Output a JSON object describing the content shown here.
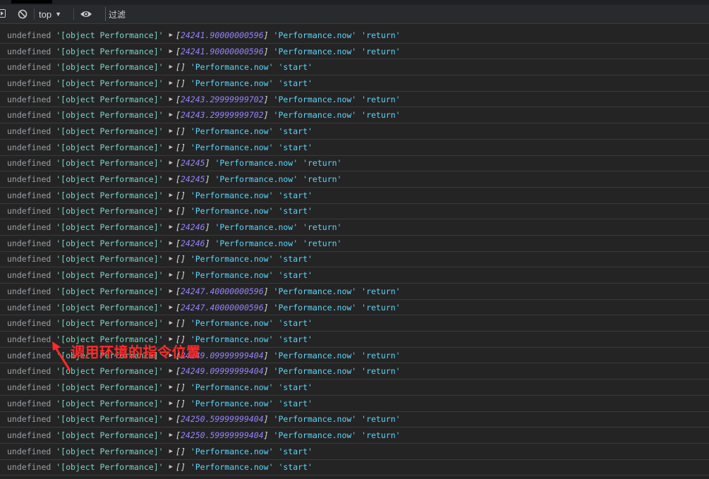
{
  "toolbar": {
    "context_label": "top",
    "filter_placeholder": "过滤"
  },
  "rows": [
    {
      "undef": "undefined",
      "perf": "'[object Performance]'",
      "arr_open": "[",
      "value": "24241.90000000596",
      "arr_close": "]",
      "fn": "'Performance.now'",
      "state": "'return'"
    },
    {
      "undef": "undefined",
      "perf": "'[object Performance]'",
      "arr_open": "[",
      "value": "24241.90000000596",
      "arr_close": "]",
      "fn": "'Performance.now'",
      "state": "'return'"
    },
    {
      "undef": "undefined",
      "perf": "'[object Performance]'",
      "arr_open": "[",
      "value": "",
      "arr_close": "]",
      "fn": "'Performance.now'",
      "state": "'start'"
    },
    {
      "undef": "undefined",
      "perf": "'[object Performance]'",
      "arr_open": "[",
      "value": "",
      "arr_close": "]",
      "fn": "'Performance.now'",
      "state": "'start'"
    },
    {
      "undef": "undefined",
      "perf": "'[object Performance]'",
      "arr_open": "[",
      "value": "24243.29999999702",
      "arr_close": "]",
      "fn": "'Performance.now'",
      "state": "'return'"
    },
    {
      "undef": "undefined",
      "perf": "'[object Performance]'",
      "arr_open": "[",
      "value": "24243.29999999702",
      "arr_close": "]",
      "fn": "'Performance.now'",
      "state": "'return'"
    },
    {
      "undef": "undefined",
      "perf": "'[object Performance]'",
      "arr_open": "[",
      "value": "",
      "arr_close": "]",
      "fn": "'Performance.now'",
      "state": "'start'"
    },
    {
      "undef": "undefined",
      "perf": "'[object Performance]'",
      "arr_open": "[",
      "value": "",
      "arr_close": "]",
      "fn": "'Performance.now'",
      "state": "'start'"
    },
    {
      "undef": "undefined",
      "perf": "'[object Performance]'",
      "arr_open": "[",
      "value": "24245",
      "arr_close": "]",
      "fn": "'Performance.now'",
      "state": "'return'"
    },
    {
      "undef": "undefined",
      "perf": "'[object Performance]'",
      "arr_open": "[",
      "value": "24245",
      "arr_close": "]",
      "fn": "'Performance.now'",
      "state": "'return'"
    },
    {
      "undef": "undefined",
      "perf": "'[object Performance]'",
      "arr_open": "[",
      "value": "",
      "arr_close": "]",
      "fn": "'Performance.now'",
      "state": "'start'"
    },
    {
      "undef": "undefined",
      "perf": "'[object Performance]'",
      "arr_open": "[",
      "value": "",
      "arr_close": "]",
      "fn": "'Performance.now'",
      "state": "'start'"
    },
    {
      "undef": "undefined",
      "perf": "'[object Performance]'",
      "arr_open": "[",
      "value": "24246",
      "arr_close": "]",
      "fn": "'Performance.now'",
      "state": "'return'"
    },
    {
      "undef": "undefined",
      "perf": "'[object Performance]'",
      "arr_open": "[",
      "value": "24246",
      "arr_close": "]",
      "fn": "'Performance.now'",
      "state": "'return'"
    },
    {
      "undef": "undefined",
      "perf": "'[object Performance]'",
      "arr_open": "[",
      "value": "",
      "arr_close": "]",
      "fn": "'Performance.now'",
      "state": "'start'"
    },
    {
      "undef": "undefined",
      "perf": "'[object Performance]'",
      "arr_open": "[",
      "value": "",
      "arr_close": "]",
      "fn": "'Performance.now'",
      "state": "'start'"
    },
    {
      "undef": "undefined",
      "perf": "'[object Performance]'",
      "arr_open": "[",
      "value": "24247.40000000596",
      "arr_close": "]",
      "fn": "'Performance.now'",
      "state": "'return'"
    },
    {
      "undef": "undefined",
      "perf": "'[object Performance]'",
      "arr_open": "[",
      "value": "24247.40000000596",
      "arr_close": "]",
      "fn": "'Performance.now'",
      "state": "'return'"
    },
    {
      "undef": "undefined",
      "perf": "'[object Performance]'",
      "arr_open": "[",
      "value": "",
      "arr_close": "]",
      "fn": "'Performance.now'",
      "state": "'start'"
    },
    {
      "undef": "undefined",
      "perf": "'[object Performance]'",
      "arr_open": "[",
      "value": "",
      "arr_close": "]",
      "fn": "'Performance.now'",
      "state": "'start'"
    },
    {
      "undef": "undefined",
      "perf": "'[object Performance]'",
      "arr_open": "[",
      "value": "24249.09999999404",
      "arr_close": "]",
      "fn": "'Performance.now'",
      "state": "'return'"
    },
    {
      "undef": "undefined",
      "perf": "'[object Performance]'",
      "arr_open": "[",
      "value": "24249.09999999404",
      "arr_close": "]",
      "fn": "'Performance.now'",
      "state": "'return'"
    },
    {
      "undef": "undefined",
      "perf": "'[object Performance]'",
      "arr_open": "[",
      "value": "",
      "arr_close": "]",
      "fn": "'Performance.now'",
      "state": "'start'"
    },
    {
      "undef": "undefined",
      "perf": "'[object Performance]'",
      "arr_open": "[",
      "value": "",
      "arr_close": "]",
      "fn": "'Performance.now'",
      "state": "'start'"
    },
    {
      "undef": "undefined",
      "perf": "'[object Performance]'",
      "arr_open": "[",
      "value": "24250.59999999404",
      "arr_close": "]",
      "fn": "'Performance.now'",
      "state": "'return'"
    },
    {
      "undef": "undefined",
      "perf": "'[object Performance]'",
      "arr_open": "[",
      "value": "24250.59999999404",
      "arr_close": "]",
      "fn": "'Performance.now'",
      "state": "'return'"
    },
    {
      "undef": "undefined",
      "perf": "'[object Performance]'",
      "arr_open": "[",
      "value": "",
      "arr_close": "]",
      "fn": "'Performance.now'",
      "state": "'start'"
    },
    {
      "undef": "undefined",
      "perf": "'[object Performance]'",
      "arr_open": "[",
      "value": "",
      "arr_close": "]",
      "fn": "'Performance.now'",
      "state": "'start'"
    }
  ],
  "annotation": {
    "text": "调用环境的指令位置",
    "color": "#ff2a2a"
  },
  "colors": {
    "background": "#242424",
    "string": "#5cd5fb",
    "number": "#9980ff",
    "undefined": "#9aa0a6"
  },
  "icons": {
    "sidebar_toggle": "sidebar-toggle-icon",
    "clear": "clear-console-icon",
    "context_dropdown": "chevron-down-icon",
    "live_expression": "eye-icon"
  }
}
